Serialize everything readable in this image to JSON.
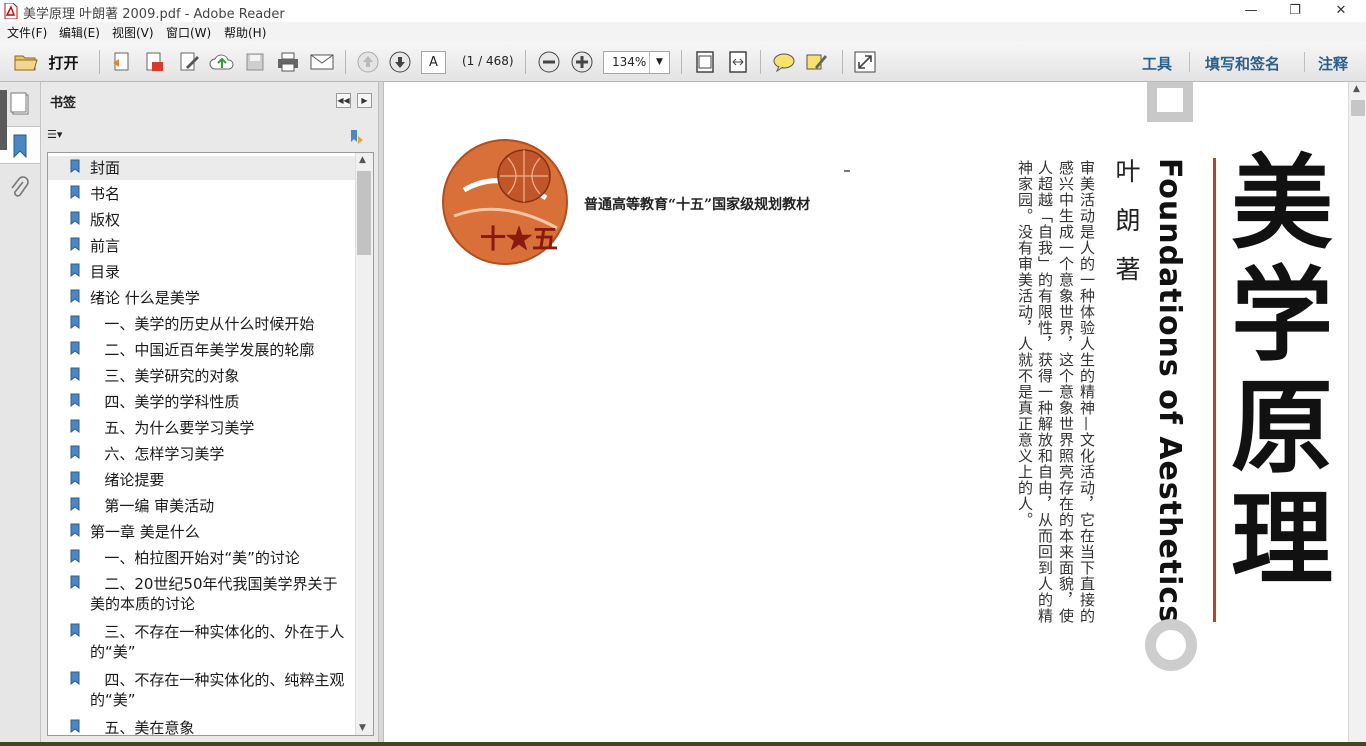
{
  "window": {
    "title": "美学原理 叶朗著 2009.pdf - Adobe Reader",
    "minimize_glyph": "—",
    "restore_glyph": "❐",
    "close_glyph": "✕"
  },
  "menu": [
    "文件(F)",
    "编辑(E)",
    "视图(V)",
    "窗口(W)",
    "帮助(H)"
  ],
  "toolbar": {
    "open_label": "打开",
    "page_value": "A",
    "page_count": "(1 / 468)",
    "zoom_value": "134%",
    "zoom_arrow": "▼",
    "links": [
      "工具",
      "填写和签名",
      "注释"
    ]
  },
  "panel": {
    "title": "书签",
    "collapse_glyph": "◀◀",
    "next_glyph": "▶",
    "options_glyph": "☰▾",
    "bookmarks": [
      {
        "label": "封面"
      },
      {
        "label": "书名"
      },
      {
        "label": "版权"
      },
      {
        "label": "前言"
      },
      {
        "label": "目录"
      },
      {
        "label": "绪论 什么是美学"
      },
      {
        "label": "   一、美学的历史从什么时候开始"
      },
      {
        "label": "   二、中国近百年美学发展的轮廓"
      },
      {
        "label": "   三、美学研究的对象"
      },
      {
        "label": "   四、美学的学科性质"
      },
      {
        "label": "   五、为什么要学习美学"
      },
      {
        "label": "   六、怎样学习美学"
      },
      {
        "label": "   绪论提要"
      },
      {
        "label": "   第一编 审美活动"
      },
      {
        "label": "第一章 美是什么"
      },
      {
        "label": "   一、柏拉图开始对“美”的讨论"
      },
      {
        "label": "   二、20世纪50年代我国美学界关于美的本质的讨论"
      },
      {
        "label": "   三、不存在一种实体化的、外在于人的“美”"
      },
      {
        "label": "   四、不存在一种实体化的、纯粹主观的“美”"
      },
      {
        "label": "   五、美在意象"
      }
    ]
  },
  "document": {
    "publisher_line": "普通高等教育“十五”国家级规划教材",
    "logo_text": "十★五",
    "intro_columns": [
      "审美活动是人的一种体验人生的精神—文化活动，它在当下直接的",
      "感兴中生成一个意象世界，这个意象世界照亮存在的本来面貌，使",
      "人超越「自我」的有限性，获得一种解放和自由，从而回到人的精",
      "神家园。没有审美活动，人就不是真正意义上的人。"
    ],
    "author": "叶 朗 著",
    "title_en": "Foundations of Aesthetics",
    "title_cn": [
      "美",
      "学",
      "原",
      "理"
    ]
  },
  "colors": {
    "link": "#2d5f8c",
    "accent_red": "#b4442a",
    "logo_orange": "#d9703a"
  }
}
